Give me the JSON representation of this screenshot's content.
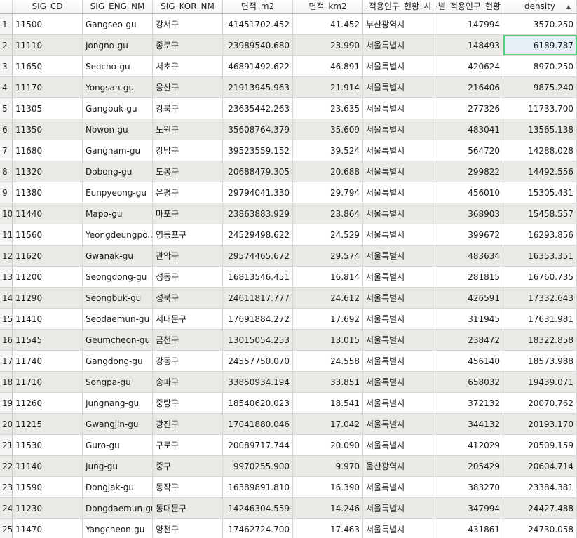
{
  "columns": [
    "SIG_CD",
    "SIG_ENG_NM",
    "SIG_KOR_NM",
    "면적_m2",
    "면적_km2",
    "_적용인구_현황_시",
    "·별_적용인구_현황",
    "density"
  ],
  "sort": {
    "column": "density",
    "direction": "ascending",
    "icon": "sort-ascending-icon"
  },
  "selected_cell": {
    "row": 2,
    "column": "density"
  },
  "rows": [
    [
      "1",
      "11500",
      "Gangseo-gu",
      "강서구",
      "41451702.452",
      "41.452",
      "부산광역시",
      "147994",
      "3570.250"
    ],
    [
      "2",
      "11110",
      "Jongno-gu",
      "종로구",
      "23989540.680",
      "23.990",
      "서울특별시",
      "148493",
      "6189.787"
    ],
    [
      "3",
      "11650",
      "Seocho-gu",
      "서초구",
      "46891492.622",
      "46.891",
      "서울특별시",
      "420624",
      "8970.250"
    ],
    [
      "4",
      "11170",
      "Yongsan-gu",
      "용산구",
      "21913945.963",
      "21.914",
      "서울특별시",
      "216406",
      "9875.240"
    ],
    [
      "5",
      "11305",
      "Gangbuk-gu",
      "강북구",
      "23635442.263",
      "23.635",
      "서울특별시",
      "277326",
      "11733.700"
    ],
    [
      "6",
      "11350",
      "Nowon-gu",
      "노원구",
      "35608764.379",
      "35.609",
      "서울특별시",
      "483041",
      "13565.138"
    ],
    [
      "7",
      "11680",
      "Gangnam-gu",
      "강남구",
      "39523559.152",
      "39.524",
      "서울특별시",
      "564720",
      "14288.028"
    ],
    [
      "8",
      "11320",
      "Dobong-gu",
      "도봉구",
      "20688479.305",
      "20.688",
      "서울특별시",
      "299822",
      "14492.556"
    ],
    [
      "9",
      "11380",
      "Eunpyeong-gu",
      "은평구",
      "29794041.330",
      "29.794",
      "서울특별시",
      "456010",
      "15305.431"
    ],
    [
      "10",
      "11440",
      "Mapo-gu",
      "마포구",
      "23863883.929",
      "23.864",
      "서울특별시",
      "368903",
      "15458.557"
    ],
    [
      "11",
      "11560",
      "Yeongdeungpo...",
      "영등포구",
      "24529498.622",
      "24.529",
      "서울특별시",
      "399672",
      "16293.856"
    ],
    [
      "12",
      "11620",
      "Gwanak-gu",
      "관악구",
      "29574465.672",
      "29.574",
      "서울특별시",
      "483634",
      "16353.351"
    ],
    [
      "13",
      "11200",
      "Seongdong-gu",
      "성동구",
      "16813546.451",
      "16.814",
      "서울특별시",
      "281815",
      "16760.735"
    ],
    [
      "14",
      "11290",
      "Seongbuk-gu",
      "성북구",
      "24611817.777",
      "24.612",
      "서울특별시",
      "426591",
      "17332.643"
    ],
    [
      "15",
      "11410",
      "Seodaemun-gu",
      "서대문구",
      "17691884.272",
      "17.692",
      "서울특별시",
      "311945",
      "17631.981"
    ],
    [
      "16",
      "11545",
      "Geumcheon-gu",
      "금천구",
      "13015054.253",
      "13.015",
      "서울특별시",
      "238472",
      "18322.858"
    ],
    [
      "17",
      "11740",
      "Gangdong-gu",
      "강동구",
      "24557750.070",
      "24.558",
      "서울특별시",
      "456140",
      "18573.988"
    ],
    [
      "18",
      "11710",
      "Songpa-gu",
      "송파구",
      "33850934.194",
      "33.851",
      "서울특별시",
      "658032",
      "19439.071"
    ],
    [
      "19",
      "11260",
      "Jungnang-gu",
      "중랑구",
      "18540620.023",
      "18.541",
      "서울특별시",
      "372132",
      "20070.762"
    ],
    [
      "20",
      "11215",
      "Gwangjin-gu",
      "광진구",
      "17041880.046",
      "17.042",
      "서울특별시",
      "344132",
      "20193.170"
    ],
    [
      "21",
      "11530",
      "Guro-gu",
      "구로구",
      "20089717.744",
      "20.090",
      "서울특별시",
      "412029",
      "20509.159"
    ],
    [
      "22",
      "11140",
      "Jung-gu",
      "중구",
      "9970255.900",
      "9.970",
      "울산광역시",
      "205429",
      "20604.714"
    ],
    [
      "23",
      "11590",
      "Dongjak-gu",
      "동작구",
      "16389891.810",
      "16.390",
      "서울특별시",
      "383270",
      "23384.381"
    ],
    [
      "24",
      "11230",
      "Dongdaemun-gu",
      "동대문구",
      "14246304.559",
      "14.246",
      "서울특별시",
      "347994",
      "24427.488"
    ],
    [
      "25",
      "11470",
      "Yangcheon-gu",
      "양천구",
      "17462724.700",
      "17.463",
      "서울특별시",
      "431861",
      "24730.058"
    ]
  ]
}
